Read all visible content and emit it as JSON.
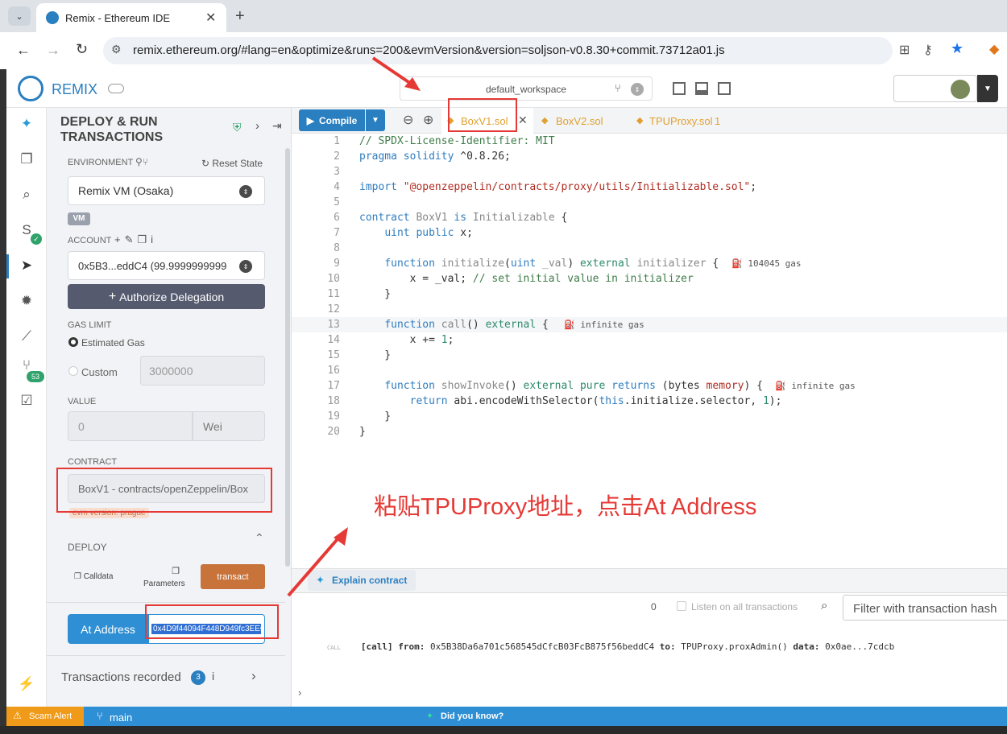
{
  "browser": {
    "tab_title": "Remix - Ethereum IDE",
    "url": "remix.ethereum.org/#lang=en&optimize&runs=200&evmVersion&version=soljson-v0.8.30+commit.73712a01.js"
  },
  "header": {
    "app_name": "REMIX",
    "workspace": "default_workspace"
  },
  "panel": {
    "title": "DEPLOY & RUN TRANSACTIONS",
    "environment_label": "ENVIRONMENT",
    "reset_state": "Reset State",
    "environment_value": "Remix VM (Osaka)",
    "vm_badge": "VM",
    "account_label": "ACCOUNT",
    "account_value": "0x5B3...eddC4 (99.9999999999",
    "authorize": "Authorize Delegation",
    "gas_label": "GAS LIMIT",
    "estimated_gas": "Estimated Gas",
    "custom": "Custom",
    "custom_value": "3000000",
    "value_label": "VALUE",
    "value_amount": "0",
    "value_unit": "Wei",
    "contract_label": "CONTRACT",
    "contract_value": "BoxV1 - contracts/openZeppelin/Box",
    "evm_version": "evm version: prague",
    "deploy_label": "DEPLOY",
    "calldata": "Calldata",
    "parameters": "Parameters",
    "transact": "transact",
    "at_address": "At Address",
    "address_value": "0x4D9f44094F448D949fc3EEC:",
    "tx_recorded": "Transactions recorded",
    "tx_count": "3"
  },
  "editor": {
    "compile": "Compile",
    "tabs": [
      {
        "label": "BoxV1.sol"
      },
      {
        "label": "BoxV2.sol"
      },
      {
        "label": "TPUProxy.sol",
        "badge": "1"
      }
    ],
    "gas_hints": {
      "initialize": "104045 gas",
      "call": "infinite gas",
      "showInvoke": "infinite gas"
    }
  },
  "annotation": "粘贴TPUProxy地址，点击At Address",
  "explain": "Explain contract",
  "terminal": {
    "count": "0",
    "listen": "Listen on all transactions",
    "filter_placeholder": "Filter with transaction hash",
    "log_tag": "CALL",
    "log_prefix": "[call]",
    "log_from_label": "from:",
    "log_from": "0x5B38Da6a701c568545dCfcB03FcB875f56beddC4",
    "log_to_label": "to:",
    "log_to": "TPUProxy.proxAdmin()",
    "log_data_label": "data:",
    "log_data": "0x0ae...7cdcb"
  },
  "status": {
    "scam": "Scam Alert",
    "branch": "main",
    "tip": "Did you know?"
  },
  "colors": {
    "accent": "#2f8fd4",
    "transact": "#c8733a",
    "at_address": "#2f8fd4",
    "authorize": "#555a6e",
    "annotation": "#e53935"
  }
}
